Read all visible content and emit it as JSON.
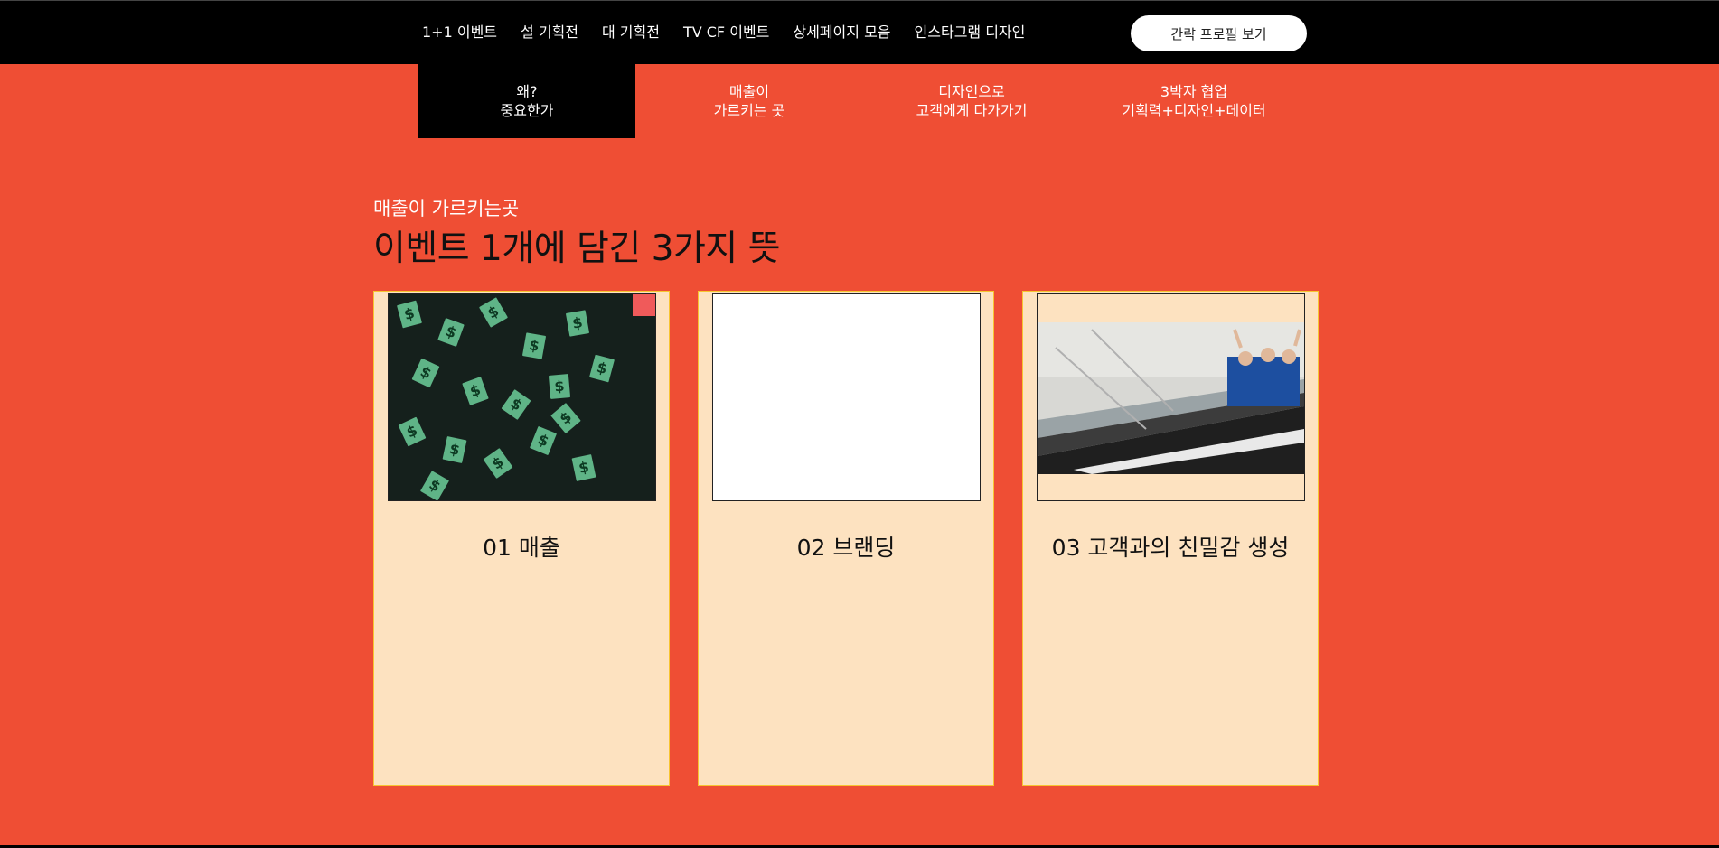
{
  "top_nav": {
    "items": [
      "1+1 이벤트",
      "설 기획전",
      "대 기획전",
      "TV CF 이벤트",
      "상세페이지 모음",
      "인스타그램 디자인"
    ],
    "profile_button": "간략 프로필 보기"
  },
  "sub_nav": {
    "tabs": [
      {
        "line1": "왜?",
        "line2": "중요한가",
        "active": true
      },
      {
        "line1": "매출이",
        "line2": "가르키는 곳",
        "active": false
      },
      {
        "line1": "디자인으로",
        "line2": "고객에게 다가가기",
        "active": false
      },
      {
        "line1": "3박자 협업",
        "line2": "기획력+디자인+데이터",
        "active": false
      }
    ]
  },
  "section": {
    "subtitle": "매출이 가르키는곳",
    "title": "이벤트 1개에 담긴 3가지 뜻"
  },
  "cards": [
    {
      "label": "01 매출",
      "thumb": "money-rain"
    },
    {
      "label": "02 브랜딩",
      "thumb": "blank"
    },
    {
      "label": "03 고객과의 친밀감 생성",
      "thumb": "escalator-photo"
    }
  ],
  "colors": {
    "background": "#ef4e34",
    "topbar": "#000000",
    "card": "#fde2c0",
    "card_border": "#f7c531",
    "badge": "#f05a5a"
  }
}
